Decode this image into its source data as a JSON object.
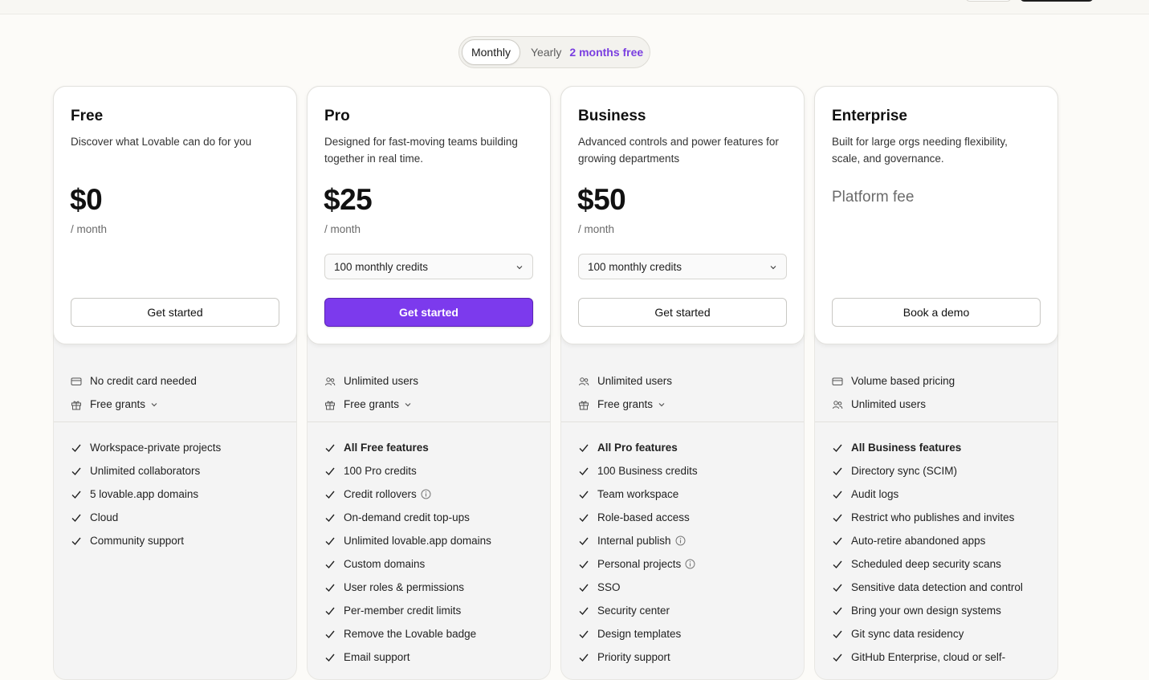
{
  "toggle": {
    "monthly": "Monthly",
    "yearly": "Yearly",
    "promo": "2 months free"
  },
  "colors": {
    "accent": "#7c3aed",
    "promo": "#7a3fe0"
  },
  "plans": [
    {
      "name": "Free",
      "description": "Discover what Lovable can do for you",
      "price": "$0",
      "period": "/ month",
      "cta": "Get started",
      "meta": [
        {
          "icon": "credit-card-icon",
          "label": "No credit card needed"
        },
        {
          "icon": "gift-icon",
          "label": "Free grants"
        }
      ],
      "features": [
        "Workspace-private projects",
        "Unlimited collaborators",
        "5 lovable.app domains",
        "Cloud",
        "Community support"
      ]
    },
    {
      "name": "Pro",
      "description": "Designed for fast-moving teams building together in real time.",
      "price": "$25",
      "period": "/ month",
      "credits": "100 monthly credits",
      "cta": "Get started",
      "meta": [
        {
          "icon": "users-icon",
          "label": "Unlimited users"
        },
        {
          "icon": "gift-icon",
          "label": "Free grants"
        }
      ],
      "features": [
        "All Free features",
        "100 Pro credits",
        "Credit rollovers",
        "On-demand credit top-ups",
        "Unlimited lovable.app domains",
        "Custom domains",
        "User roles & permissions",
        "Per-member credit limits",
        "Remove the Lovable badge",
        "Email support"
      ]
    },
    {
      "name": "Business",
      "description": "Advanced controls and power features for growing departments",
      "price": "$50",
      "period": "/ month",
      "credits": "100 monthly credits",
      "cta": "Get started",
      "meta": [
        {
          "icon": "users-icon",
          "label": "Unlimited users"
        },
        {
          "icon": "gift-icon",
          "label": "Free grants"
        }
      ],
      "features": [
        "All Pro features",
        "100 Business credits",
        "Team workspace",
        "Role-based access",
        "Internal publish",
        "Personal projects",
        "SSO",
        "Security center",
        "Design templates",
        "Priority support"
      ]
    },
    {
      "name": "Enterprise",
      "description": "Built for large orgs needing flexibility, scale, and governance.",
      "platform": "Platform fee",
      "cta": "Book a demo",
      "meta": [
        {
          "icon": "credit-card-icon",
          "label": "Volume based pricing"
        },
        {
          "icon": "users-icon",
          "label": "Unlimited users"
        }
      ],
      "features": [
        "All Business features",
        "Directory sync (SCIM)",
        "Audit logs",
        "Restrict who publishes and invites",
        "Auto-retire abandoned apps",
        "Scheduled deep security scans",
        "Sensitive data detection and control",
        "Bring your own design systems",
        "Git sync data residency",
        "GitHub Enterprise, cloud or self-"
      ]
    }
  ]
}
